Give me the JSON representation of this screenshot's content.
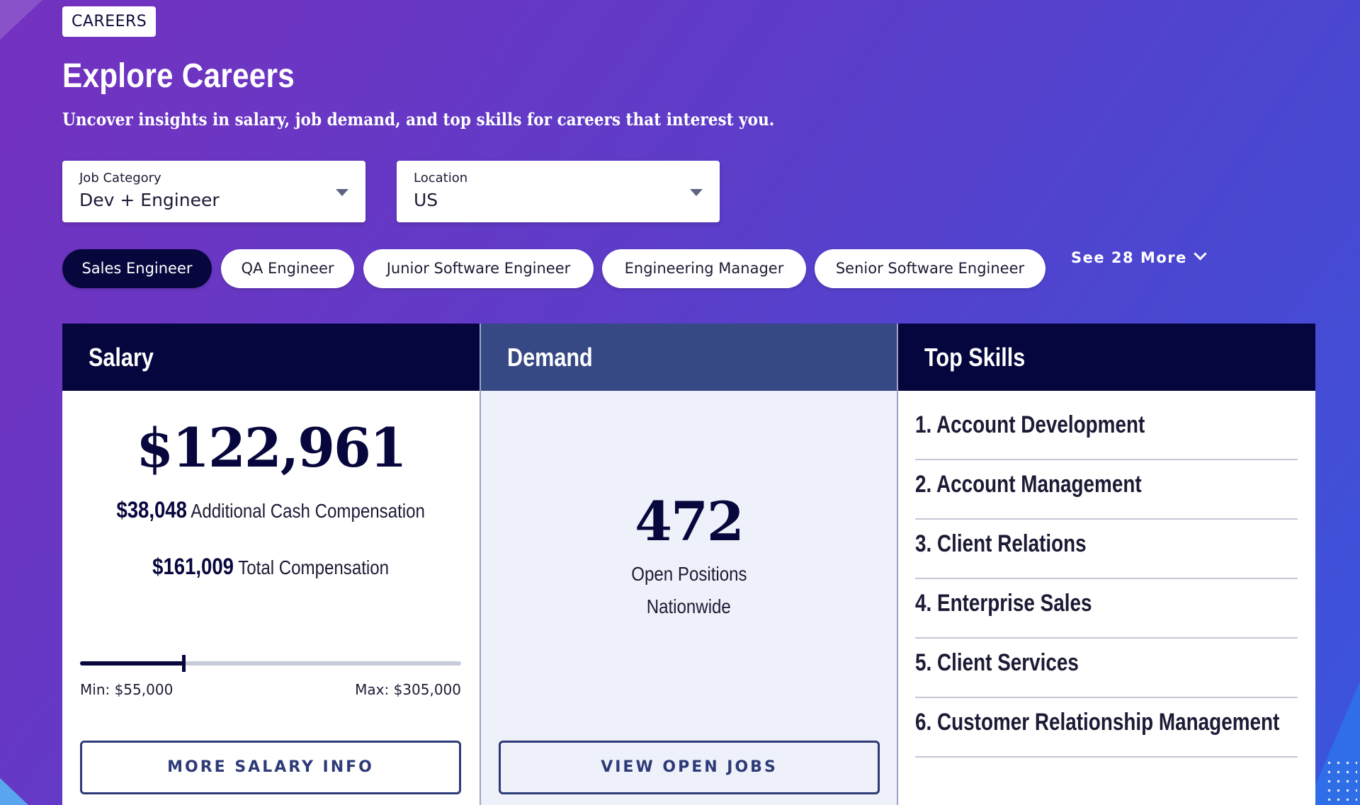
{
  "page": {
    "badge": "CAREERS",
    "title": "Explore Careers",
    "subtitle": "Uncover insights in salary, job demand, and top skills for careers that interest you."
  },
  "filters": {
    "job_category": {
      "label": "Job Category",
      "value": "Dev + Engineer"
    },
    "location": {
      "label": "Location",
      "value": "US"
    }
  },
  "roles": [
    "Sales Engineer",
    "QA Engineer",
    "Junior Software Engineer",
    "Engineering Manager",
    "Senior Software Engineer"
  ],
  "selected_role": "Sales Engineer",
  "see_more": "See 28 More",
  "salary": {
    "heading": "Salary",
    "base": "$122,961",
    "additional_cash_amount": "$38,048",
    "additional_cash_label": "Additional Cash Compensation",
    "total_amount": "$161,009",
    "total_label": "Total Compensation",
    "range_min_label": "Min: $55,000",
    "range_max_label": "Max: $305,000",
    "range_min": 55000,
    "range_max": 305000,
    "marker_value": 122961,
    "button": "MORE SALARY INFO"
  },
  "demand": {
    "heading": "Demand",
    "open_positions": "472",
    "label_line1": "Open Positions",
    "label_line2": "Nationwide",
    "button": "VIEW OPEN JOBS"
  },
  "skills": {
    "heading": "Top Skills",
    "items": [
      "1. Account Development",
      "2. Account Management",
      "3. Client Relations",
      "4. Enterprise Sales",
      "5. Client Services",
      "6. Customer Relationship Management"
    ]
  },
  "colors": {
    "navy": "#05063d",
    "demand_header": "#374985",
    "button_border": "#2d3a78"
  }
}
